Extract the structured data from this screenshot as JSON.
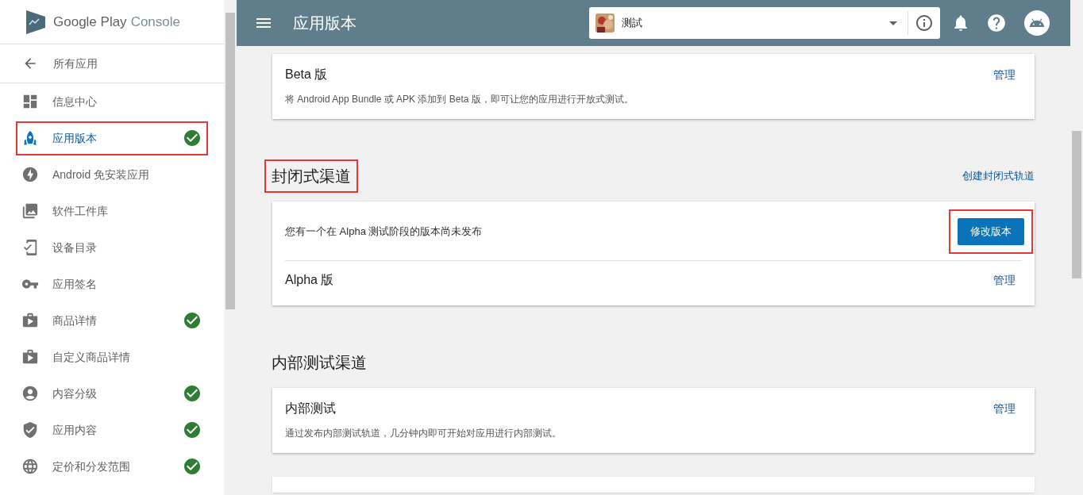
{
  "brand": {
    "name": "Google Play",
    "product": "Console"
  },
  "back_link": "所有应用",
  "sidebar": {
    "items": [
      {
        "label": "信息中心",
        "selected": false,
        "done": false,
        "highlighted": false
      },
      {
        "label": "应用版本",
        "selected": true,
        "done": true,
        "highlighted": true
      },
      {
        "label": "Android 免安装应用",
        "selected": false,
        "done": false,
        "highlighted": false
      },
      {
        "label": "软件工件库",
        "selected": false,
        "done": false,
        "highlighted": false
      },
      {
        "label": "设备目录",
        "selected": false,
        "done": false,
        "highlighted": false
      },
      {
        "label": "应用签名",
        "selected": false,
        "done": false,
        "highlighted": false
      },
      {
        "label": "商品详情",
        "selected": false,
        "done": true,
        "highlighted": false
      },
      {
        "label": "自定义商品详情",
        "selected": false,
        "done": false,
        "highlighted": false
      },
      {
        "label": "内容分级",
        "selected": false,
        "done": true,
        "highlighted": false
      },
      {
        "label": "应用内容",
        "selected": false,
        "done": true,
        "highlighted": false
      },
      {
        "label": "定价和分发范围",
        "selected": false,
        "done": true,
        "highlighted": false
      }
    ]
  },
  "top_bar": {
    "title": "应用版本",
    "app_selector": {
      "value": "测試"
    }
  },
  "sections": [
    {
      "cards": [
        {
          "title": "Beta 版",
          "action": "管理",
          "description": "将 Android App Bundle 或 APK 添加到 Beta 版，即可让您的应用进行开放式测试。"
        }
      ]
    },
    {
      "title": "封闭式渠道",
      "title_highlighted": true,
      "link": "创建封闭式轨道",
      "cards": [
        {
          "notice": "您有一个在 Alpha 测试阶段的版本尚未发布",
          "button": "修改版本",
          "button_highlighted": true,
          "title": "Alpha 版",
          "action": "管理"
        }
      ]
    },
    {
      "title": "内部测试渠道",
      "title_highlighted": false,
      "cards": [
        {
          "title": "内部测试",
          "action": "管理",
          "description": "通过发布内部测试轨道，几分钟内即可开始对应用进行内部测试。"
        },
        {
          "kind": "partial"
        }
      ]
    }
  ]
}
